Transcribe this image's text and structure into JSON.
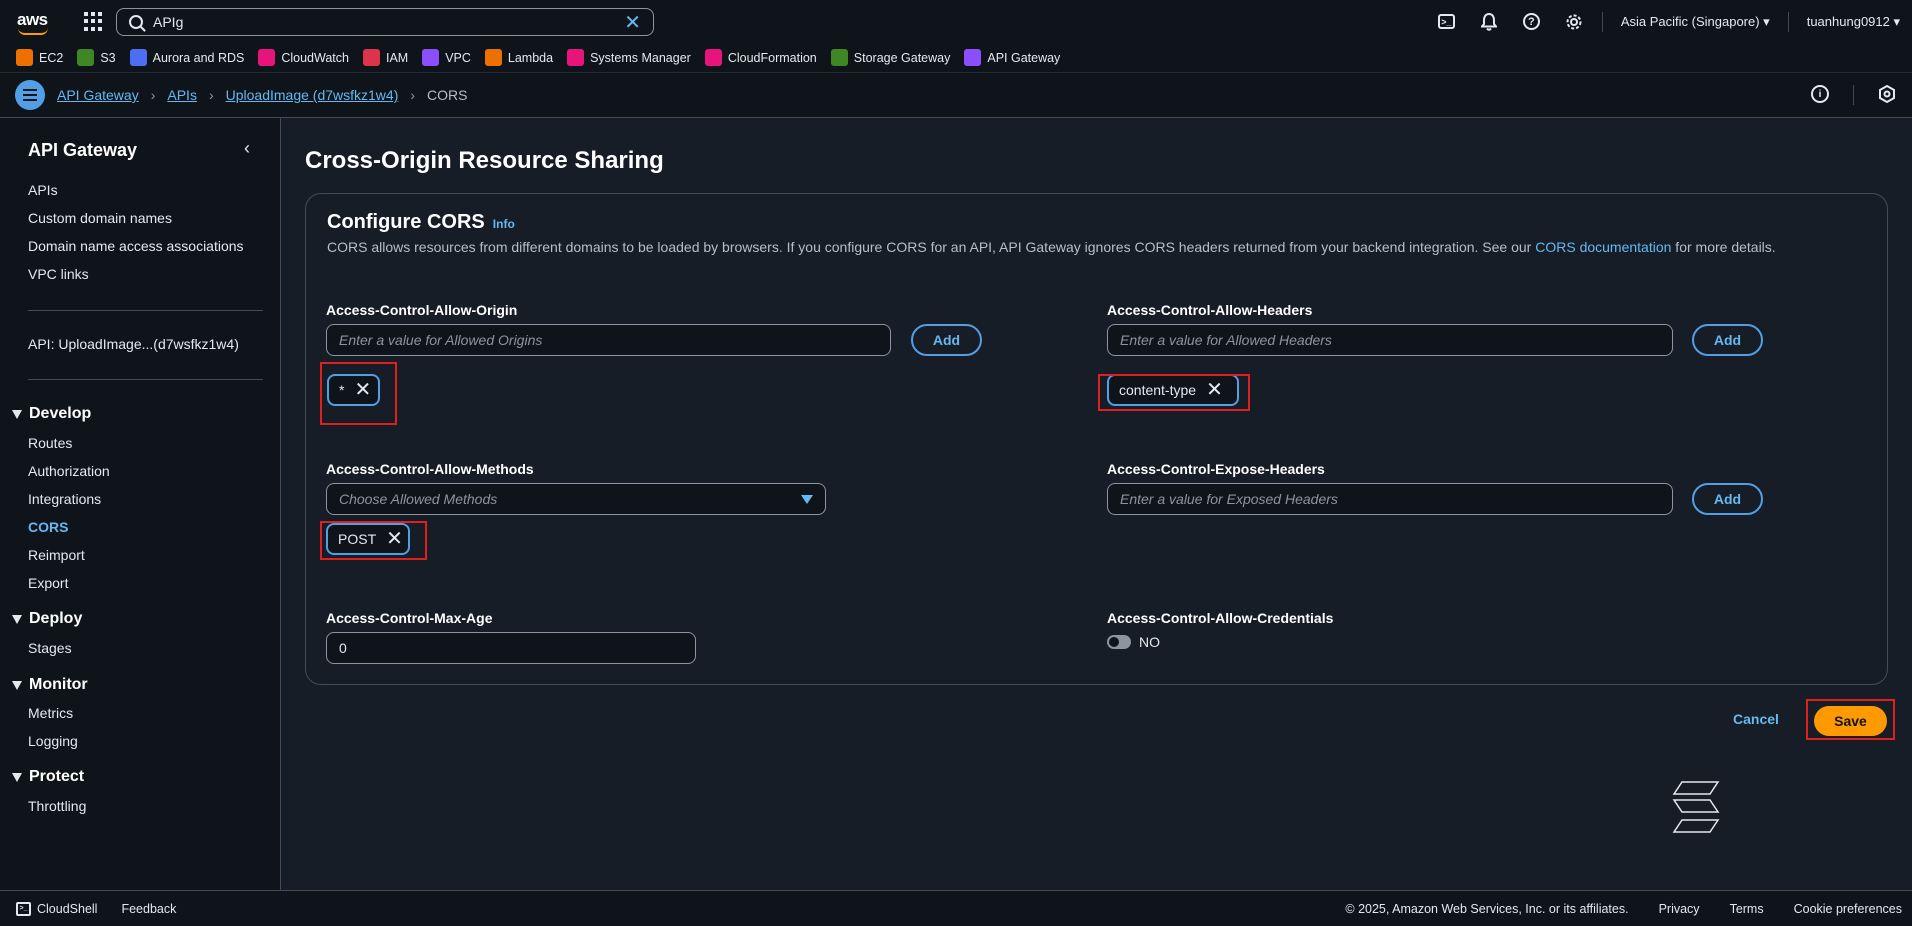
{
  "topnav": {
    "logo": "aws",
    "search_value": "APIg",
    "region": "Asia Pacific (Singapore) ▾",
    "user": "tuanhung0912 ▾",
    "icons": [
      "cloudshell-icon",
      "bell-icon",
      "help-icon",
      "gear-icon"
    ]
  },
  "favorites": [
    {
      "label": "EC2",
      "color": "#ed7100"
    },
    {
      "label": "S3",
      "color": "#3f8624"
    },
    {
      "label": "Aurora and RDS",
      "color": "#4d6ef0"
    },
    {
      "label": "CloudWatch",
      "color": "#e7157b"
    },
    {
      "label": "IAM",
      "color": "#dd344c"
    },
    {
      "label": "VPC",
      "color": "#8c4fff"
    },
    {
      "label": "Lambda",
      "color": "#ed7100"
    },
    {
      "label": "Systems Manager",
      "color": "#e7157b"
    },
    {
      "label": "CloudFormation",
      "color": "#e7157b"
    },
    {
      "label": "Storage Gateway",
      "color": "#3f8624"
    },
    {
      "label": "API Gateway",
      "color": "#8c4fff"
    }
  ],
  "breadcrumb": {
    "items": [
      "API Gateway",
      "APIs",
      "UploadImage (d7wsfkz1w4)"
    ],
    "current": "CORS"
  },
  "sidebar": {
    "title": "API Gateway",
    "top_links": [
      "APIs",
      "Custom domain names",
      "Domain name access associations",
      "VPC links"
    ],
    "api_label": "API: UploadImage...(d7wsfkz1w4)",
    "develop": {
      "label": "Develop",
      "items": [
        "Routes",
        "Authorization",
        "Integrations",
        "CORS",
        "Reimport",
        "Export"
      ]
    },
    "deploy": {
      "label": "Deploy",
      "items": [
        "Stages"
      ]
    },
    "monitor": {
      "label": "Monitor",
      "items": [
        "Metrics",
        "Logging"
      ]
    },
    "protect": {
      "label": "Protect",
      "items": [
        "Throttling"
      ]
    }
  },
  "main": {
    "title": "Cross-Origin Resource Sharing",
    "panel_title": "Configure CORS",
    "info": "Info",
    "desc_before": "CORS allows resources from different domains to be loaded by browsers. If you configure CORS for an API, API Gateway ignores CORS headers returned from your backend integration. See our ",
    "desc_link": "CORS documentation",
    "desc_after": " for more details.",
    "allow_origin": {
      "label": "Access-Control-Allow-Origin",
      "placeholder": "Enter a value for Allowed Origins",
      "add": "Add",
      "token": "*"
    },
    "allow_headers": {
      "label": "Access-Control-Allow-Headers",
      "placeholder": "Enter a value for Allowed Headers",
      "add": "Add",
      "token": "content-type"
    },
    "allow_methods": {
      "label": "Access-Control-Allow-Methods",
      "placeholder": "Choose Allowed Methods",
      "token": "POST"
    },
    "expose_headers": {
      "label": "Access-Control-Expose-Headers",
      "placeholder": "Enter a value for Exposed Headers",
      "add": "Add"
    },
    "max_age": {
      "label": "Access-Control-Max-Age",
      "value": "0"
    },
    "allow_credentials": {
      "label": "Access-Control-Allow-Credentials",
      "toggle_text": "NO"
    },
    "cancel": "Cancel",
    "save": "Save"
  },
  "footer": {
    "cloudshell": "CloudShell",
    "feedback": "Feedback",
    "copyright": "© 2025, Amazon Web Services, Inc. or its affiliates.",
    "privacy": "Privacy",
    "terms": "Terms",
    "cookies": "Cookie preferences"
  }
}
